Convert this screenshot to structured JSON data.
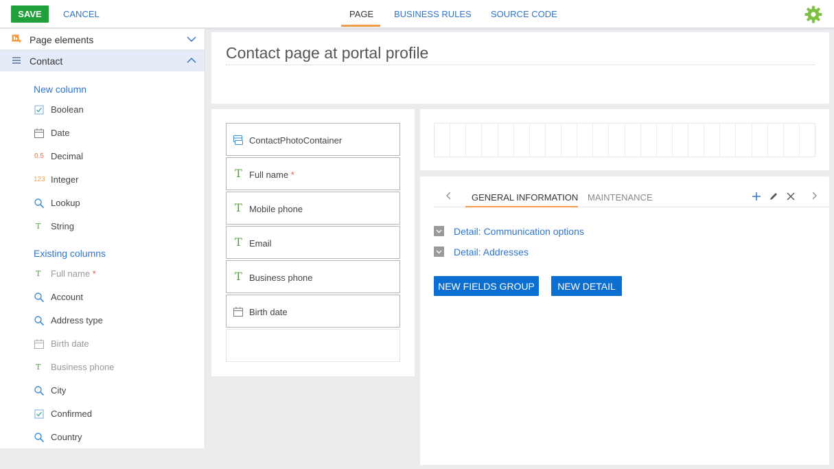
{
  "toolbar": {
    "save_label": "SAVE",
    "cancel_label": "CANCEL",
    "tabs": [
      {
        "label": "PAGE",
        "active": true
      },
      {
        "label": "BUSINESS RULES",
        "active": false
      },
      {
        "label": "SOURCE CODE",
        "active": false
      }
    ],
    "gear_icon": "gear-icon",
    "gear_color": "#7dc142"
  },
  "sidebar": {
    "sections": [
      {
        "label": "Page elements",
        "expanded": false
      },
      {
        "label": "Contact",
        "expanded": true
      }
    ],
    "new_column_title": "New column",
    "new_columns": [
      {
        "label": "Boolean",
        "icon": "checkbox-icon"
      },
      {
        "label": "Date",
        "icon": "calendar-icon"
      },
      {
        "label": "Decimal",
        "icon": "decimal-icon",
        "badge": "0.5"
      },
      {
        "label": "Integer",
        "icon": "integer-icon",
        "badge": "123"
      },
      {
        "label": "Lookup",
        "icon": "search-icon"
      },
      {
        "label": "String",
        "icon": "text-icon"
      }
    ],
    "existing_columns_title": "Existing columns",
    "existing_columns": [
      {
        "label": "Full name",
        "required": "*",
        "icon": "text-icon",
        "dim": true
      },
      {
        "label": "Account",
        "icon": "search-icon",
        "dim": false
      },
      {
        "label": "Address type",
        "icon": "search-icon",
        "dim": false
      },
      {
        "label": "Birth date",
        "icon": "calendar-icon",
        "dim": true
      },
      {
        "label": "Business phone",
        "icon": "text-icon",
        "dim": true
      },
      {
        "label": "City",
        "icon": "search-icon",
        "dim": false
      },
      {
        "label": "Confirmed",
        "icon": "checkbox-icon",
        "dim": false
      },
      {
        "label": "Country",
        "icon": "search-icon",
        "dim": false
      }
    ]
  },
  "page": {
    "title": "Contact page at portal profile"
  },
  "fields": [
    {
      "label": "ContactPhotoContainer",
      "icon": "container-icon"
    },
    {
      "label": "Full name",
      "required": "*",
      "icon": "text-icon"
    },
    {
      "label": "Mobile phone",
      "icon": "text-icon"
    },
    {
      "label": "Email",
      "icon": "text-icon"
    },
    {
      "label": "Business phone",
      "icon": "text-icon"
    },
    {
      "label": "Birth date",
      "icon": "calendar-icon"
    }
  ],
  "details": {
    "tabs": [
      {
        "label": "GENERAL INFORMATION",
        "active": true
      },
      {
        "label": "MAINTENANCE",
        "active": false
      }
    ],
    "rows": [
      {
        "label": "Detail: Communication options"
      },
      {
        "label": "Detail: Addresses"
      }
    ],
    "new_fields_group_label": "NEW FIELDS GROUP",
    "new_detail_label": "NEW DETAIL"
  },
  "colors": {
    "accent_blue": "#2f74c8",
    "save_green": "#1fa03b",
    "tab_orange": "#f39a4a",
    "button_blue": "#0b6fd1",
    "string_green": "#4ea23a"
  }
}
